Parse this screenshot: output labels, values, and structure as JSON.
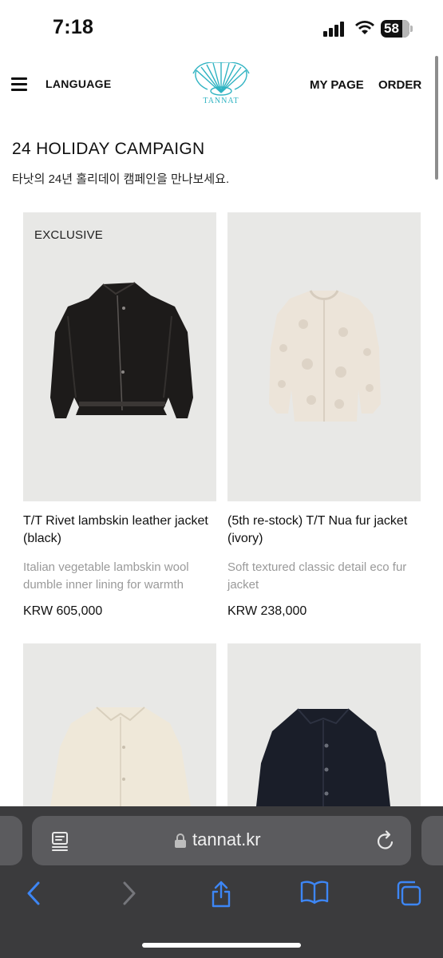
{
  "status_bar": {
    "time": "7:18",
    "battery": "58"
  },
  "header": {
    "language_label": "LANGUAGE",
    "logo_text": "TANNAT",
    "mypage_label": "MY PAGE",
    "order_label": "ORDER"
  },
  "campaign": {
    "title": "24 HOLIDAY CAMPAIGN",
    "subtitle": "타낫의 24년 홀리데이 캠페인을 만나보세요."
  },
  "products": [
    {
      "badge": "EXCLUSIVE",
      "name": "T/T Rivet lambskin leather jacket (black)",
      "description": "Italian vegetable lambskin wool dumble inner lining for warmth",
      "price": "KRW 605,000"
    },
    {
      "badge": "",
      "name": "(5th re-stock) T/T Nua fur jacket (ivory)",
      "description": "Soft textured classic detail eco fur jacket",
      "price": "KRW 238,000"
    },
    {
      "badge": "",
      "name": "",
      "description": "",
      "price": ""
    },
    {
      "badge": "",
      "name": "",
      "description": "",
      "price": ""
    }
  ],
  "browser": {
    "url": "tannat.kr"
  },
  "colors": {
    "brand_teal": "#2fb3c2",
    "browser_bar": "#3b3b3d",
    "toolbar_blue": "#3d86f5",
    "product_bg": "#e8e8e6"
  }
}
